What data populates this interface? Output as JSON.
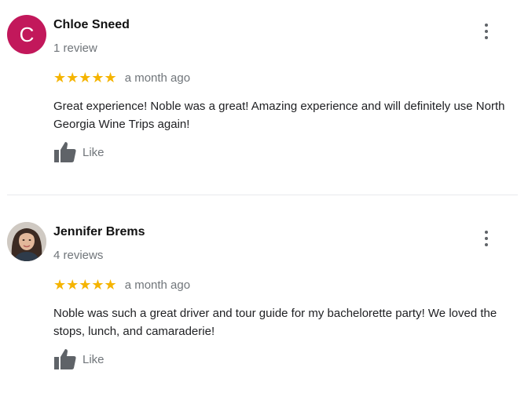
{
  "reviews": [
    {
      "author": "Chloe Sneed",
      "avatar_letter": "C",
      "review_count": "1 review",
      "stars": "★★★★★",
      "rating": 5,
      "date": "a month ago",
      "text": "Great experience! Noble was a great! Amazing experience and will definitely use North Georgia Wine Trips again!",
      "like_label": "Like"
    },
    {
      "author": "Jennifer Brems",
      "avatar_letter": "",
      "review_count": "4 reviews",
      "stars": "★★★★★",
      "rating": 5,
      "date": "a month ago",
      "text": "Noble was such a great driver and tour guide for my bachelorette party! We loved the stops, lunch, and camaraderie!",
      "like_label": "Like"
    }
  ],
  "colors": {
    "star": "#f5b400",
    "avatar_chloe": "#c2185b",
    "secondary_text": "#70757a",
    "icon": "#5f6368"
  },
  "icons": {
    "more": "more-vert-icon",
    "like": "thumb-up-icon",
    "star": "star-icon"
  }
}
